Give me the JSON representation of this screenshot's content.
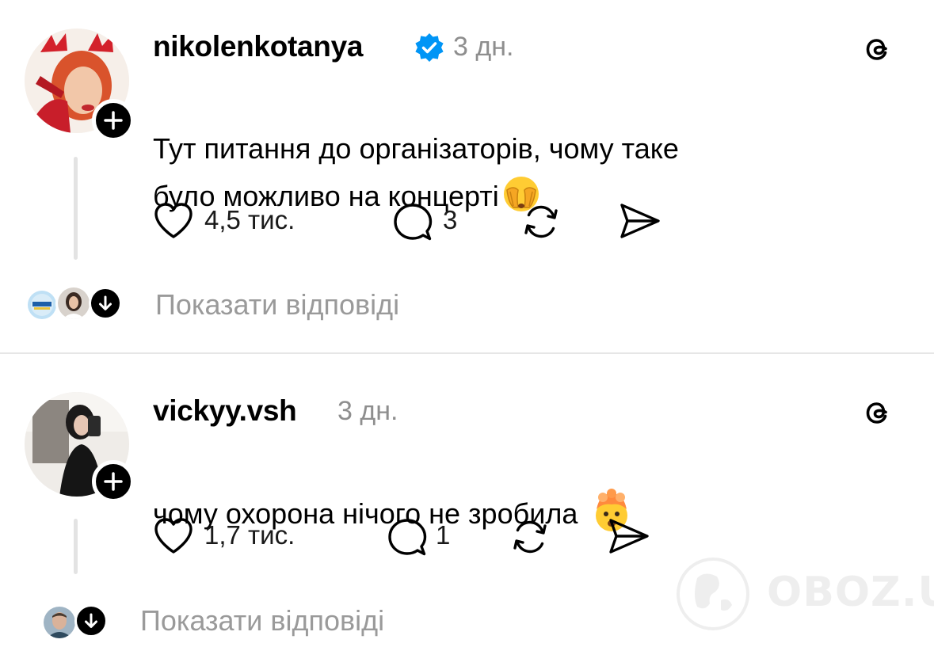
{
  "posts": [
    {
      "username": "nikolenkotanya",
      "verified": true,
      "time": "3 дн.",
      "text": "Тут питання до організаторів, чому таке\nбуло можливо на концерті",
      "emoji": "face-with-hand-over-eyes",
      "likes": "4,5 тис.",
      "comments": "3",
      "show_replies": "Показати відповіді"
    },
    {
      "username": "vickyy.vsh",
      "verified": false,
      "time": "3 дн.",
      "text": "чому охорона нічого не зробила",
      "emoji": "exploding-head",
      "likes": "1,7 тис.",
      "comments": "1",
      "show_replies": "Показати відповіді"
    }
  ],
  "watermark": "OBOZ.UA",
  "colors": {
    "verified_blue": "#0095f6",
    "muted_text": "#8e8e8e",
    "divider": "#e6e6e6"
  }
}
